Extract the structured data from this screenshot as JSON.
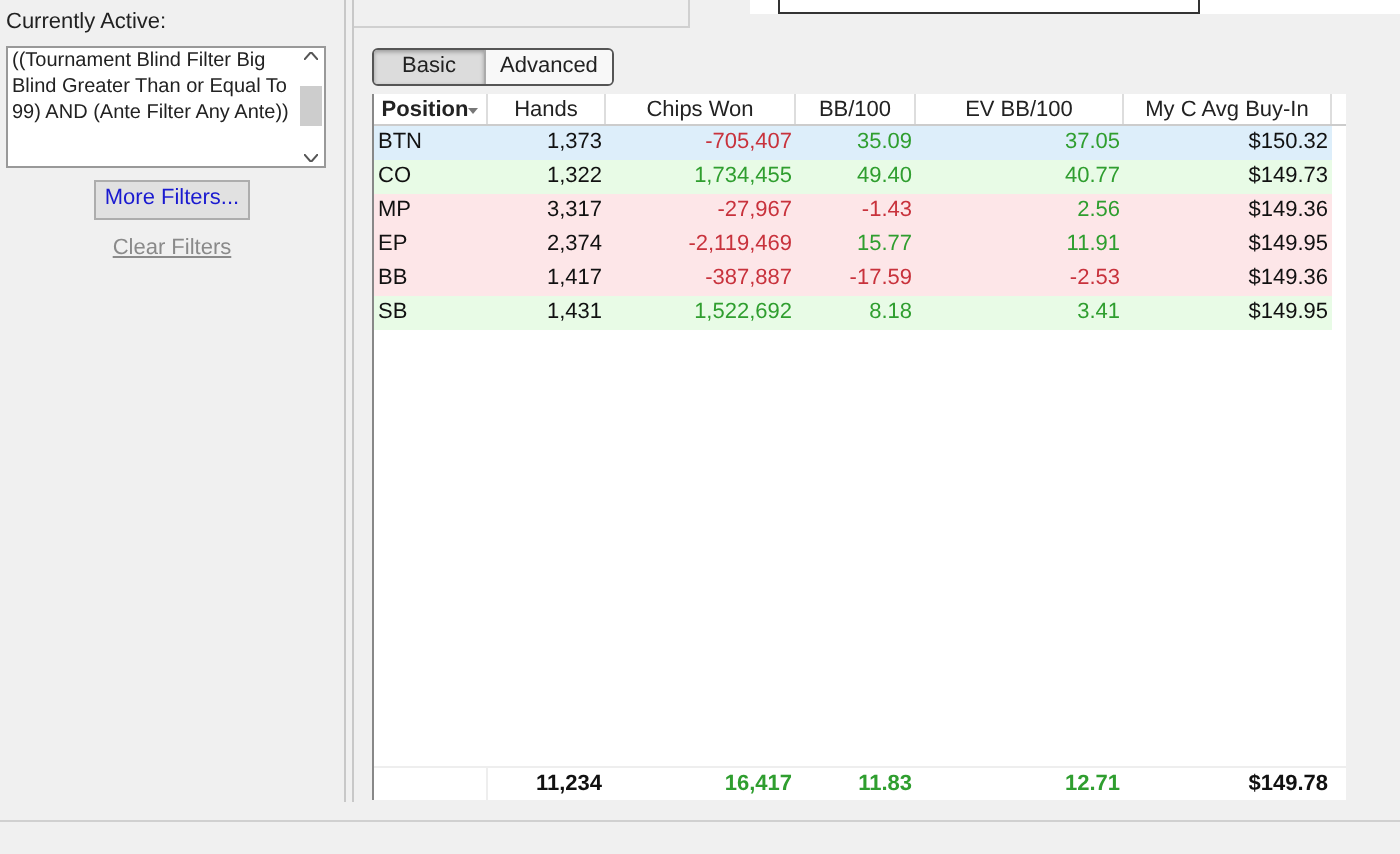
{
  "filters": {
    "heading": "Currently Active:",
    "text": "((Tournament Blind Filter Big Blind Greater Than or Equal To 99) AND (Ante Filter Any Ante))",
    "more_button": "More Filters...",
    "clear_link": {
      "label": "Clear Filters",
      "disabled": true
    }
  },
  "tabs": [
    {
      "label": "Basic",
      "selected": true
    },
    {
      "label": "Advanced",
      "selected": false
    }
  ],
  "table": {
    "columns": [
      {
        "label": "Position",
        "sorted": true
      },
      {
        "label": "Hands",
        "sorted": false
      },
      {
        "label": "Chips Won",
        "sorted": false
      },
      {
        "label": "BB/100",
        "sorted": false
      },
      {
        "label": "EV BB/100",
        "sorted": false
      },
      {
        "label": "My C Avg Buy-In",
        "sorted": false
      }
    ],
    "rows": [
      {
        "color": "#ddeefa",
        "cells": [
          {
            "text": "BTN",
            "kind": "plain"
          },
          {
            "text": "1,373",
            "kind": "plain"
          },
          {
            "text": "-705,407",
            "kind": "negative"
          },
          {
            "text": "35.09",
            "kind": "positive"
          },
          {
            "text": "37.05",
            "kind": "positive"
          },
          {
            "text": "$150.32",
            "kind": "plain"
          }
        ]
      },
      {
        "color": "#e8fbe6",
        "cells": [
          {
            "text": "CO",
            "kind": "plain"
          },
          {
            "text": "1,322",
            "kind": "plain"
          },
          {
            "text": "1,734,455",
            "kind": "positive"
          },
          {
            "text": "49.40",
            "kind": "positive"
          },
          {
            "text": "40.77",
            "kind": "positive"
          },
          {
            "text": "$149.73",
            "kind": "plain"
          }
        ]
      },
      {
        "color": "#fde6e8",
        "cells": [
          {
            "text": "MP",
            "kind": "plain"
          },
          {
            "text": "3,317",
            "kind": "plain"
          },
          {
            "text": "-27,967",
            "kind": "negative"
          },
          {
            "text": "-1.43",
            "kind": "negative"
          },
          {
            "text": "2.56",
            "kind": "positive"
          },
          {
            "text": "$149.36",
            "kind": "plain"
          }
        ]
      },
      {
        "color": "#fde6e8",
        "cells": [
          {
            "text": "EP",
            "kind": "plain"
          },
          {
            "text": "2,374",
            "kind": "plain"
          },
          {
            "text": "-2,119,469",
            "kind": "negative"
          },
          {
            "text": "15.77",
            "kind": "positive"
          },
          {
            "text": "11.91",
            "kind": "positive"
          },
          {
            "text": "$149.95",
            "kind": "plain"
          }
        ]
      },
      {
        "color": "#fde6e8",
        "cells": [
          {
            "text": "BB",
            "kind": "plain"
          },
          {
            "text": "1,417",
            "kind": "plain"
          },
          {
            "text": "-387,887",
            "kind": "negative"
          },
          {
            "text": "-17.59",
            "kind": "negative"
          },
          {
            "text": "-2.53",
            "kind": "negative"
          },
          {
            "text": "$149.36",
            "kind": "plain"
          }
        ]
      },
      {
        "color": "#e8fbe6",
        "cells": [
          {
            "text": "SB",
            "kind": "plain"
          },
          {
            "text": "1,431",
            "kind": "plain"
          },
          {
            "text": "1,522,692",
            "kind": "positive"
          },
          {
            "text": "8.18",
            "kind": "positive"
          },
          {
            "text": "3.41",
            "kind": "positive"
          },
          {
            "text": "$149.95",
            "kind": "plain"
          }
        ]
      }
    ],
    "totals": [
      {
        "text": "11,234",
        "kind": "plain"
      },
      {
        "text": "16,417",
        "kind": "positive"
      },
      {
        "text": "11.83",
        "kind": "positive"
      },
      {
        "text": "12.71",
        "kind": "positive"
      },
      {
        "text": "$149.78",
        "kind": "plain"
      }
    ]
  }
}
